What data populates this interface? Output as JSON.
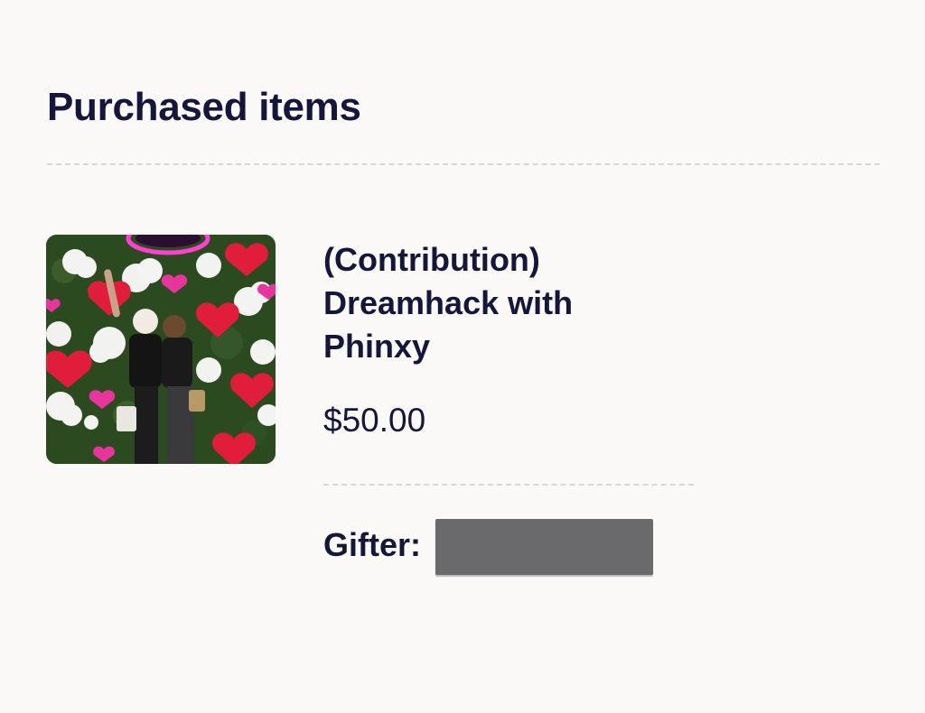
{
  "section": {
    "title": "Purchased items"
  },
  "item": {
    "image_alt": "Two people posing in front of a heart and cloud decorated wall",
    "name": "(Contribution) Dreamhack with Phinxy",
    "price": "$50.00",
    "gifter_label": "Gifter:",
    "gifter_value": ""
  },
  "colors": {
    "background": "#fbf9f8",
    "text": "#15163b",
    "divider": "#d9d7d6",
    "redaction": "#6a6a6c"
  }
}
